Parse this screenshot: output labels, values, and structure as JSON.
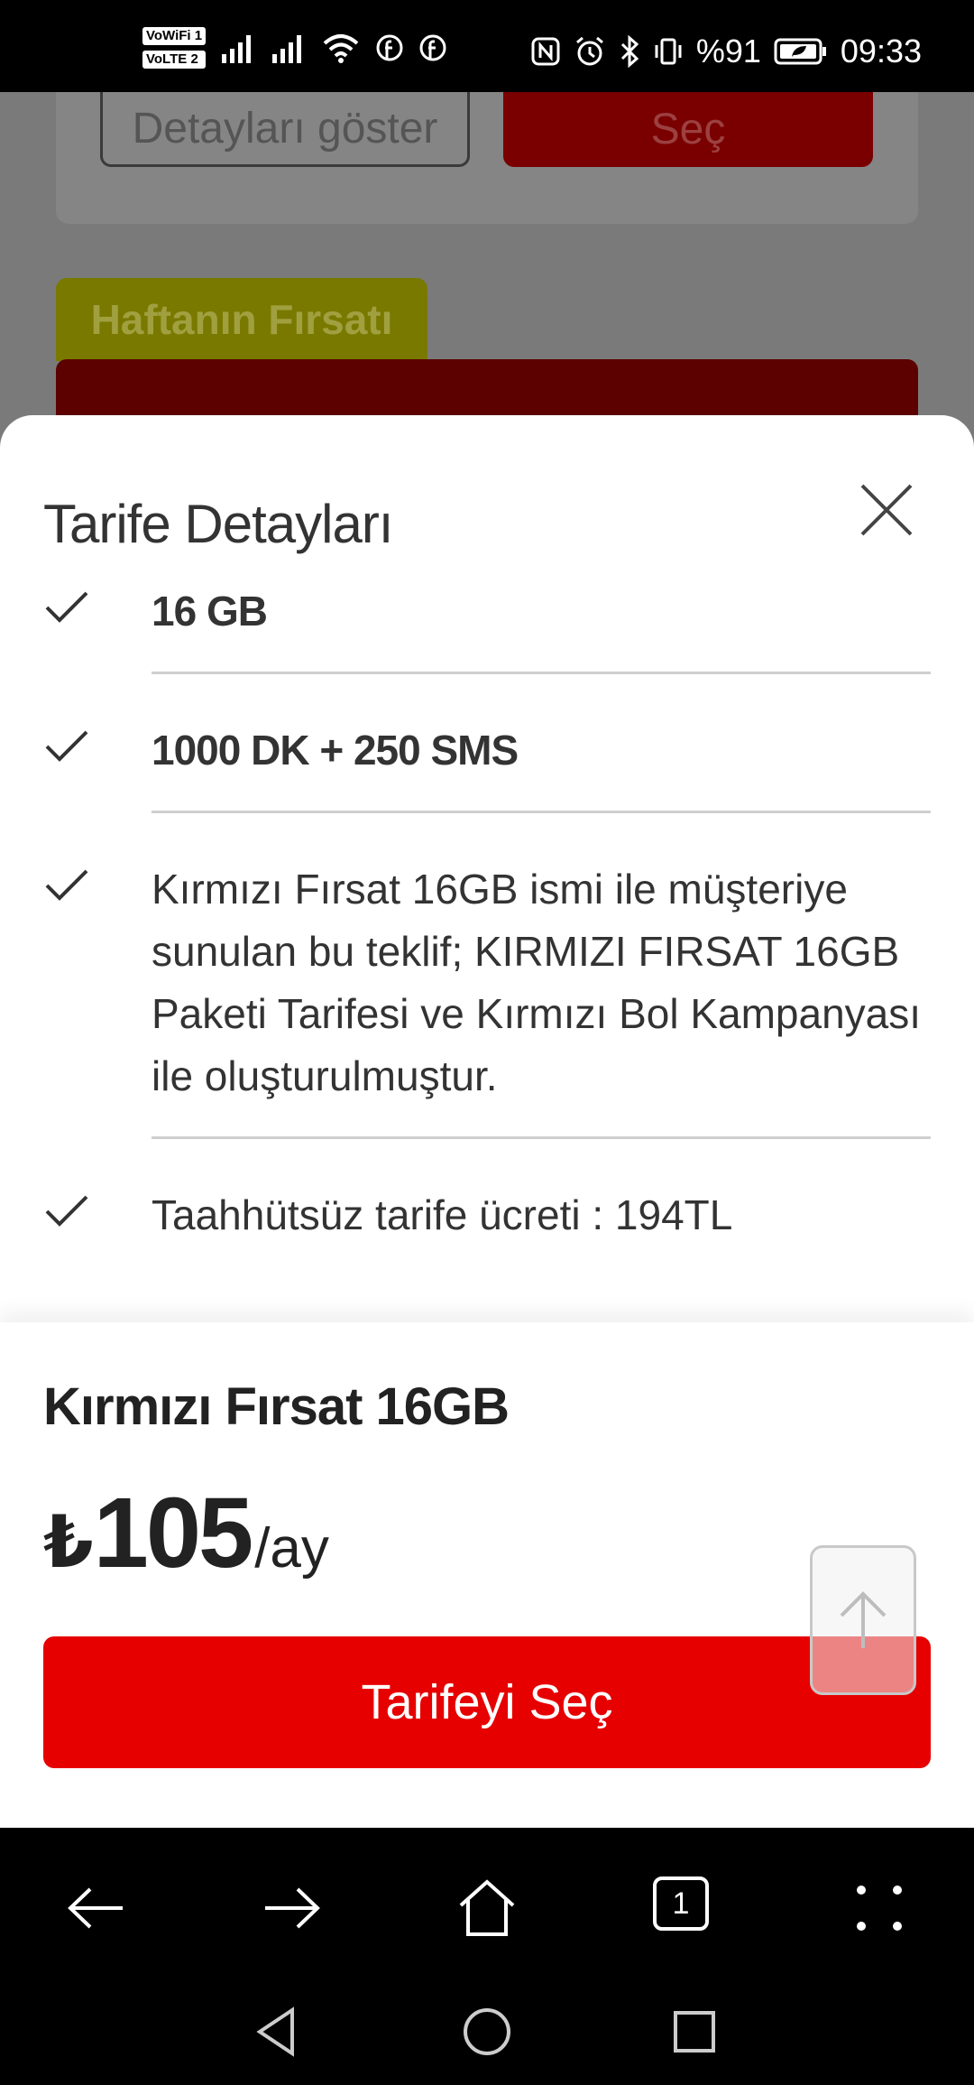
{
  "status_bar": {
    "badge_vowifi": "VoWiFi 1",
    "badge_volte": "VoLTE 2",
    "battery_percent": "%91",
    "time": "09:33"
  },
  "background": {
    "details_button": "Detayları göster",
    "select_button": "Seç",
    "weekly_deal_tag": "Haftanın Fırsatı"
  },
  "sheet": {
    "title": "Tarife Detayları",
    "features": [
      {
        "text": "16 GB",
        "bold": true
      },
      {
        "text": "1000 DK + 250 SMS",
        "bold": true
      },
      {
        "text": "Kırmızı Fırsat 16GB ismi ile müşteriye sunulan bu teklif; KIRMIZI FIRSAT 16GB Paketi Tarifesi ve Kırmızı Bol Kampanyası ile oluşturulmuştur.",
        "bold": false
      },
      {
        "text": "Taahhütsüz tarife ücreti : 194TL",
        "bold": false
      }
    ]
  },
  "summary": {
    "plan_name": "Kırmızı Fırsat 16GB",
    "currency": "₺",
    "price": "105",
    "unit": "/ay",
    "select_button": "Tarifeyi Seç"
  },
  "browser": {
    "tab_count": "1"
  },
  "colors": {
    "accent": "#e60000",
    "text": "#333333",
    "divider": "#cfcfcf"
  }
}
